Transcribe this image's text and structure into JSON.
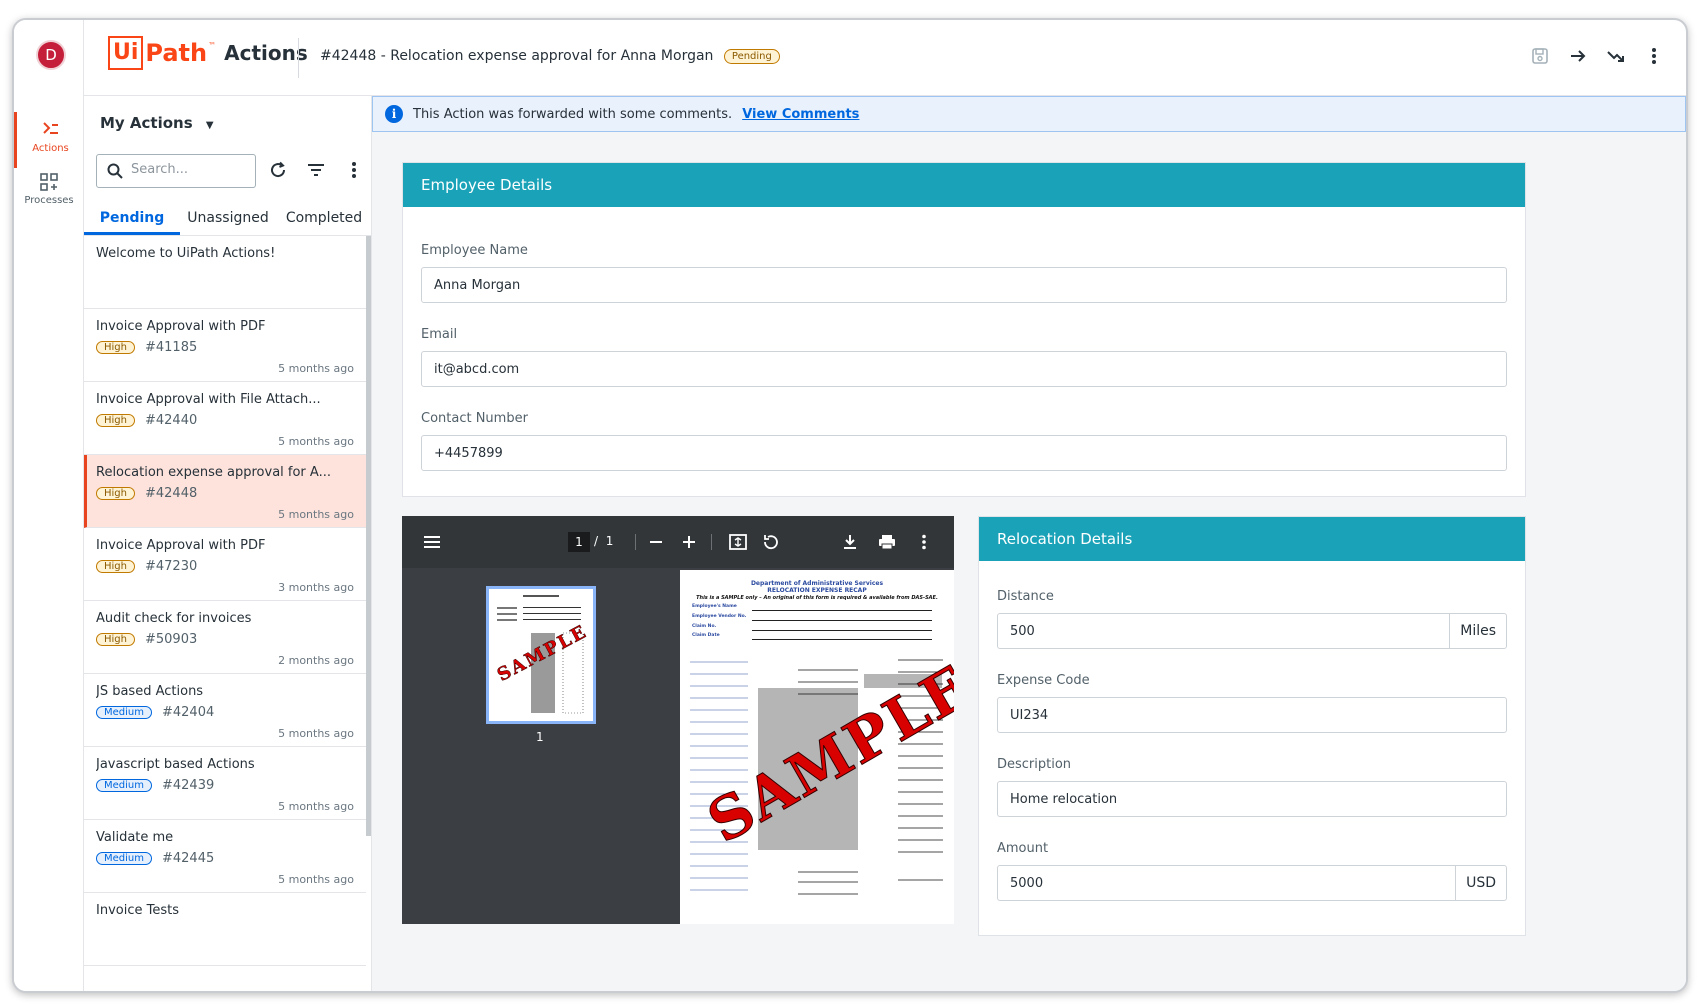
{
  "rail": {
    "avatar_letter": "D",
    "items": [
      {
        "label": "Actions",
        "icon": "actions-icon",
        "active": true
      },
      {
        "label": "Processes",
        "icon": "processes-icon",
        "active": false
      }
    ]
  },
  "header": {
    "logo_ui": "Ui",
    "logo_path": "Path",
    "logo_tm": "™",
    "app_name": "Actions",
    "title": "#42448 - Relocation expense approval for Anna Morgan",
    "status": "Pending",
    "icons": [
      "save-icon",
      "forward-icon",
      "trend-icon",
      "more-icon"
    ]
  },
  "list": {
    "title": "My Actions",
    "search_placeholder": "Search...",
    "tabs": [
      "Pending",
      "Unassigned",
      "Completed"
    ],
    "items": [
      {
        "title": "Welcome to UiPath Actions!",
        "priority": "",
        "id": "",
        "time": ""
      },
      {
        "title": "Invoice Approval with PDF",
        "priority": "High",
        "id": "#41185",
        "time": "5 months ago"
      },
      {
        "title": "Invoice Approval with File Attach...",
        "priority": "High",
        "id": "#42440",
        "time": "5 months ago"
      },
      {
        "title": "Relocation expense approval for A...",
        "priority": "High",
        "id": "#42448",
        "time": "5 months ago",
        "selected": true
      },
      {
        "title": "Invoice Approval with PDF",
        "priority": "High",
        "id": "#47230",
        "time": "3 months ago"
      },
      {
        "title": "Audit check for invoices",
        "priority": "High",
        "id": "#50903",
        "time": "2 months ago"
      },
      {
        "title": "JS based Actions",
        "priority": "Medium",
        "id": "#42404",
        "time": "5 months ago"
      },
      {
        "title": "Javascript based Actions",
        "priority": "Medium",
        "id": "#42439",
        "time": "5 months ago"
      },
      {
        "title": "Validate me",
        "priority": "Medium",
        "id": "#42445",
        "time": "5 months ago"
      },
      {
        "title": "Invoice Tests",
        "priority": "",
        "id": "",
        "time": ""
      }
    ]
  },
  "banner": {
    "text": "This Action was forwarded with some comments.",
    "link": "View Comments"
  },
  "employee": {
    "heading": "Employee Details",
    "name_label": "Employee Name",
    "name_value": "Anna Morgan",
    "email_label": "Email",
    "email_value": "it@abcd.com",
    "contact_label": "Contact Number",
    "contact_value": "+4457899"
  },
  "pdf": {
    "page_current": "1",
    "page_sep": "/",
    "page_total": "1",
    "thumb_label": "1",
    "doc_dept": "Department of Administrative Services",
    "doc_title": "RELOCATION EXPENSE RECAP",
    "doc_note": "This is a SAMPLE only – An original of this form is required & available from DAS-SAE.",
    "doc_fields": [
      "Employee's Name",
      "Employee Vendor No.",
      "Claim No.",
      "Claim Date"
    ],
    "watermark": "SAMPLE"
  },
  "relocation": {
    "heading": "Relocation Details",
    "distance_label": "Distance",
    "distance_value": "500",
    "distance_unit": "Miles",
    "code_label": "Expense Code",
    "code_value": "UI234",
    "desc_label": "Description",
    "desc_value": "Home relocation",
    "amount_label": "Amount",
    "amount_value": "5000",
    "amount_unit": "USD"
  },
  "colors": {
    "brand": "#fa4616",
    "card_header": "#1aa3b8",
    "link": "#0067df",
    "selected_row": "#fde3dc"
  }
}
